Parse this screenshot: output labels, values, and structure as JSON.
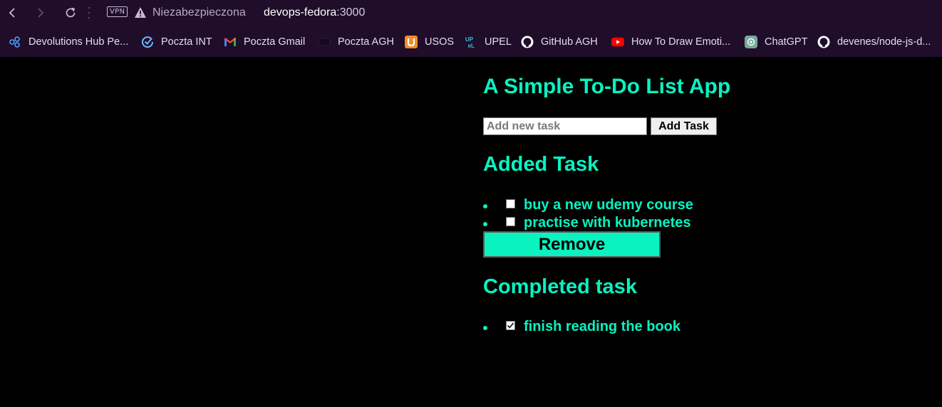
{
  "browser": {
    "vpn_label": "VPN",
    "security_label": "Niezabezpieczona",
    "url_host": "devops-fedora",
    "url_port": ":3000"
  },
  "bookmarks": [
    {
      "label": "Devolutions Hub Pe...",
      "icon": "devolutions-icon"
    },
    {
      "label": "Poczta INT",
      "icon": "check-circle-icon"
    },
    {
      "label": "Poczta Gmail",
      "icon": "gmail-icon"
    },
    {
      "label": "Poczta AGH",
      "icon": "agh-mail-icon"
    },
    {
      "label": "USOS",
      "icon": "usos-icon"
    },
    {
      "label": "UPEL",
      "icon": "upel-icon"
    },
    {
      "label": "GitHub AGH",
      "icon": "github-icon"
    },
    {
      "label": "How To Draw Emoti...",
      "icon": "youtube-icon"
    },
    {
      "label": "ChatGPT",
      "icon": "chatgpt-icon"
    },
    {
      "label": "devenes/node-js-d...",
      "icon": "github-icon"
    }
  ],
  "app": {
    "title": "A Simple To-Do List App",
    "input_placeholder": "Add new task",
    "input_value": "",
    "add_button_label": "Add Task",
    "added_heading": "Added Task",
    "added_tasks": [
      {
        "text": "buy a new udemy course",
        "checked": false
      },
      {
        "text": "practise with kubernetes",
        "checked": false
      }
    ],
    "remove_button_label": "Remove",
    "completed_heading": "Completed task",
    "completed_tasks": [
      {
        "text": "finish reading the book",
        "checked": true
      }
    ]
  },
  "colors": {
    "accent": "#09f2c0",
    "background": "#000000",
    "chrome": "#1f0d2a"
  }
}
